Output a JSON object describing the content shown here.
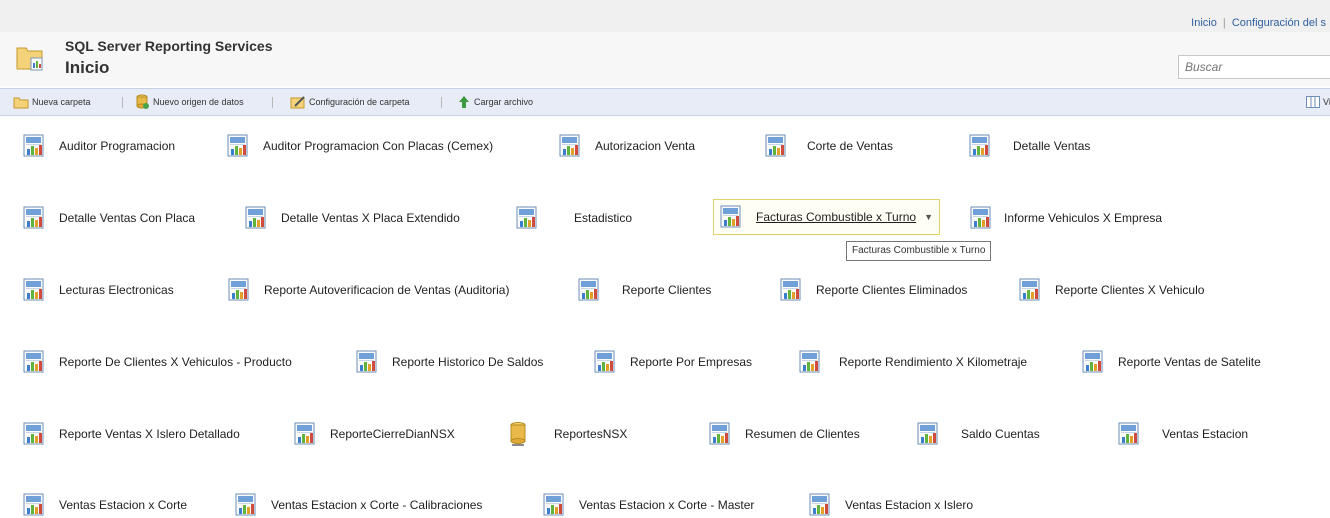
{
  "top_links": {
    "home": "Inicio",
    "separator": "|",
    "settings": "Configuración del s"
  },
  "header": {
    "app_title": "SQL Server Reporting Services",
    "page_title": "Inicio"
  },
  "search": {
    "placeholder": "Buscar"
  },
  "toolbar": {
    "new_folder": "Nueva carpeta",
    "new_data_source": "Nuevo origen de datos",
    "folder_settings": "Configuración de carpeta",
    "upload_file": "Cargar archivo",
    "view_partial": "Vi"
  },
  "items": [
    "Auditor Programacion",
    "Auditor Programacion Con Placas (Cemex)",
    "Autorizacion Venta",
    "Corte de Ventas",
    "Detalle Ventas",
    "Detalle Ventas Con Placa",
    "Detalle Ventas X Placa Extendido",
    "Estadistico",
    "Facturas Combustible x Turno",
    "Informe Vehiculos X Empresa",
    "Lecturas Electronicas",
    "Reporte Autoverificacion de Ventas (Auditoria)",
    "Reporte Clientes",
    "Reporte Clientes Eliminados",
    "Reporte Clientes X Vehiculo",
    "Reporte De Clientes X Vehiculos - Producto",
    "Reporte Historico De Saldos",
    "Reporte Por Empresas",
    "Reporte Rendimiento X Kilometraje",
    "Reporte Ventas de Satelite",
    "Reporte Ventas X Islero Detallado",
    "ReporteCierreDianNSX",
    "ReportesNSX",
    "Resumen de Clientes",
    "Saldo Cuentas",
    "Ventas Estacion",
    "Ventas Estacion x Corte",
    "Ventas Estacion x Corte - Calibraciones",
    "Ventas Estacion x Corte - Master",
    "Ventas Estacion x Islero"
  ],
  "tooltip": "Facturas Combustible x Turno",
  "icons": {
    "report": "report-icon",
    "data_source": "data-source-icon",
    "folder": "folder-icon",
    "settings": "folder-settings-icon",
    "upload": "upload-icon",
    "view": "view-icon"
  }
}
